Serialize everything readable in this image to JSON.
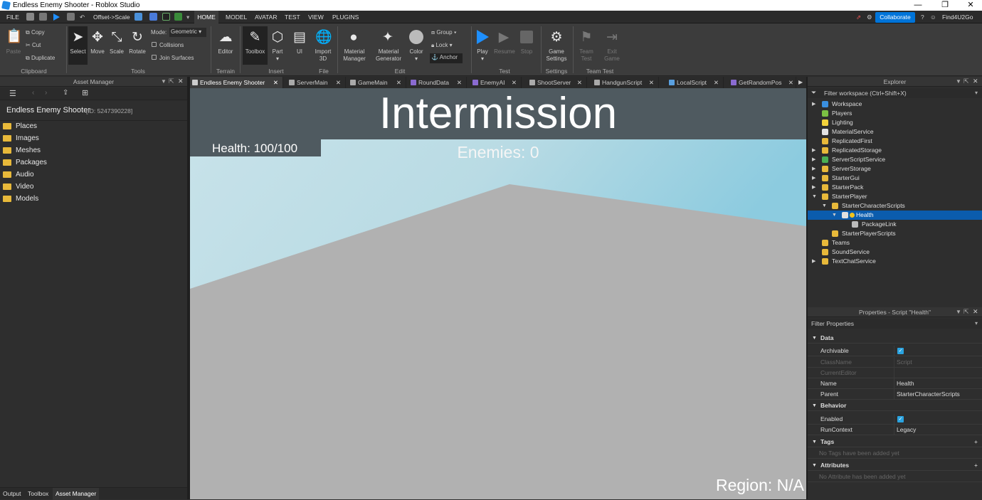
{
  "window": {
    "title": "Endless Enemy Shooter - Roblox Studio",
    "minimize": "—",
    "maximize": "❐",
    "close": "✕"
  },
  "menubar": {
    "file": "FILE",
    "offset_scale": "Offset->Scale",
    "tabs": [
      "HOME",
      "MODEL",
      "AVATAR",
      "TEST",
      "VIEW",
      "PLUGINS"
    ],
    "collaborate": "Collaborate",
    "user": "Find4U2Go"
  },
  "ribbon": {
    "clipboard": {
      "paste": "Paste",
      "copy": "Copy",
      "cut": "Cut",
      "duplicate": "Duplicate",
      "group": "Clipboard"
    },
    "tools": {
      "select": "Select",
      "move": "Move",
      "scale": "Scale",
      "rotate": "Rotate",
      "mode_label": "Mode:",
      "mode_value": "Geometric",
      "collisions": "Collisions",
      "join_surfaces": "Join Surfaces",
      "group": "Tools"
    },
    "terrain": {
      "editor": "Editor",
      "group": "Terrain"
    },
    "insert": {
      "toolbox": "Toolbox",
      "part": "Part",
      "ui": "UI",
      "import3d_1": "Import",
      "import3d_2": "3D",
      "group": "Insert"
    },
    "file": {
      "group": "File"
    },
    "edit": {
      "material_manager_1": "Material",
      "material_manager_2": "Manager",
      "material_generator_1": "Material",
      "material_generator_2": "Generator",
      "color": "Color",
      "group_btn": "Group",
      "lock": "Lock",
      "anchor": "Anchor",
      "group": "Edit"
    },
    "test": {
      "play": "Play",
      "resume": "Resume",
      "stop": "Stop",
      "group": "Test"
    },
    "settings": {
      "game_settings_1": "Game",
      "game_settings_2": "Settings",
      "group": "Settings"
    },
    "team_test": {
      "team_test_1": "Team",
      "team_test_2": "Test",
      "exit_game_1": "Exit",
      "exit_game_2": "Game",
      "group": "Team Test"
    }
  },
  "asset_manager": {
    "title": "Asset Manager",
    "game_name": "Endless Enemy Shooter",
    "game_id": "[ID: 5247390228]",
    "items": [
      "Places",
      "Images",
      "Meshes",
      "Packages",
      "Audio",
      "Video",
      "Models"
    ],
    "bottom_tabs": [
      "Output",
      "Toolbox",
      "Asset Manager"
    ]
  },
  "doc_tabs": [
    "Endless Enemy Shooter",
    "ServerMain",
    "GameMain",
    "RoundData",
    "EnemyAI",
    "ShootServer",
    "HandgunScript",
    "LocalScript",
    "GetRandomPos"
  ],
  "viewport": {
    "intermission": "Intermission",
    "health": "Health: 100/100",
    "enemies": "Enemies: 0",
    "region": "Region: N/A"
  },
  "explorer": {
    "title": "Explorer",
    "filter": "Filter workspace (Ctrl+Shift+X)",
    "items": [
      "Workspace",
      "Players",
      "Lighting",
      "MaterialService",
      "ReplicatedFirst",
      "ReplicatedStorage",
      "ServerScriptService",
      "ServerStorage",
      "StarterGui",
      "StarterPack",
      "StarterPlayer",
      "StarterCharacterScripts",
      "Health",
      "PackageLink",
      "StarterPlayerScripts",
      "Teams",
      "SoundService",
      "TextChatService"
    ]
  },
  "properties": {
    "title": "Properties - Script \"Health\"",
    "filter": "Filter Properties",
    "data_section": "Data",
    "archivable": "Archivable",
    "classname": "ClassName",
    "classname_value": "Script",
    "current_editor": "CurrentEditor",
    "name": "Name",
    "name_value": "Health",
    "parent": "Parent",
    "parent_value": "StarterCharacterScripts",
    "behavior_section": "Behavior",
    "enabled": "Enabled",
    "run_context": "RunContext",
    "run_context_value": "Legacy",
    "tags_section": "Tags",
    "tags_empty": "No Tags have been added yet",
    "attributes_section": "Attributes",
    "attributes_empty": "No Attribute has been added yet",
    "checked": "✓",
    "add": "+"
  },
  "icons": {
    "arrow_right": "▶",
    "arrow_down": "▼",
    "dropdown": "▾",
    "close": "✕",
    "pin": "⇱"
  },
  "colors": {
    "accent": "#0074d9",
    "selection": "#0b5cad",
    "sky": "#a9d6e2",
    "baseplate": "#b0b0b0"
  }
}
